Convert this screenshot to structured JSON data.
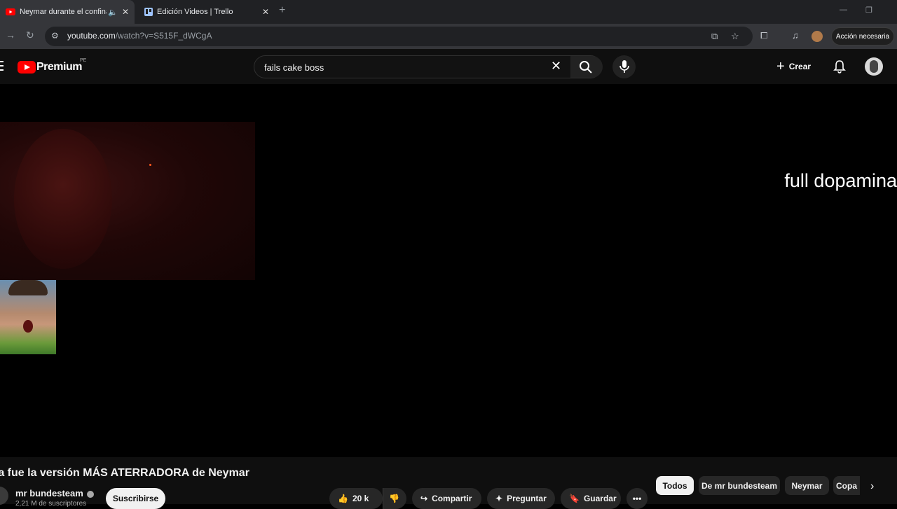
{
  "browser": {
    "tabs": [
      {
        "title": "Neymar durante el confinamiento",
        "active": true
      },
      {
        "title": "Edición Videos | Trello",
        "active": false
      }
    ],
    "url_host": "youtube.com",
    "url_path": "/watch?v=S515F_dWCgA",
    "action_button": "Acción necesaria"
  },
  "masthead": {
    "brand": "Premium",
    "region": "PE",
    "search_value": "fails cake boss",
    "create_label": "Crear"
  },
  "player": {
    "overlay_text": "full dopamina"
  },
  "video": {
    "title": "ta fue la versión MÁS ATERRADORA de Neymar",
    "channel": "mr bundesteam",
    "subscribers": "2,21 M de suscriptores",
    "subscribe_label": "Suscribirse",
    "likes": "20 k",
    "share_label": "Compartir",
    "ask_label": "Preguntar",
    "save_label": "Guardar"
  },
  "chips": [
    "Todos",
    "De mr bundesteam",
    "Neymar",
    "Copa"
  ],
  "colors": {
    "accent": "#ff0000",
    "background": "#000000"
  },
  "icons": [
    "youtube-favicon",
    "trello-favicon",
    "speaker-icon",
    "close-icon",
    "new-tab-icon",
    "back-icon",
    "reload-icon",
    "tune-icon",
    "install-icon",
    "star-icon",
    "extensions-icon",
    "media-icon",
    "search-icon",
    "mic-icon",
    "bell-icon",
    "like-icon",
    "dislike-icon",
    "share-icon",
    "sparkle-icon",
    "bookmark-icon",
    "more-icon",
    "chevron-right-icon"
  ]
}
